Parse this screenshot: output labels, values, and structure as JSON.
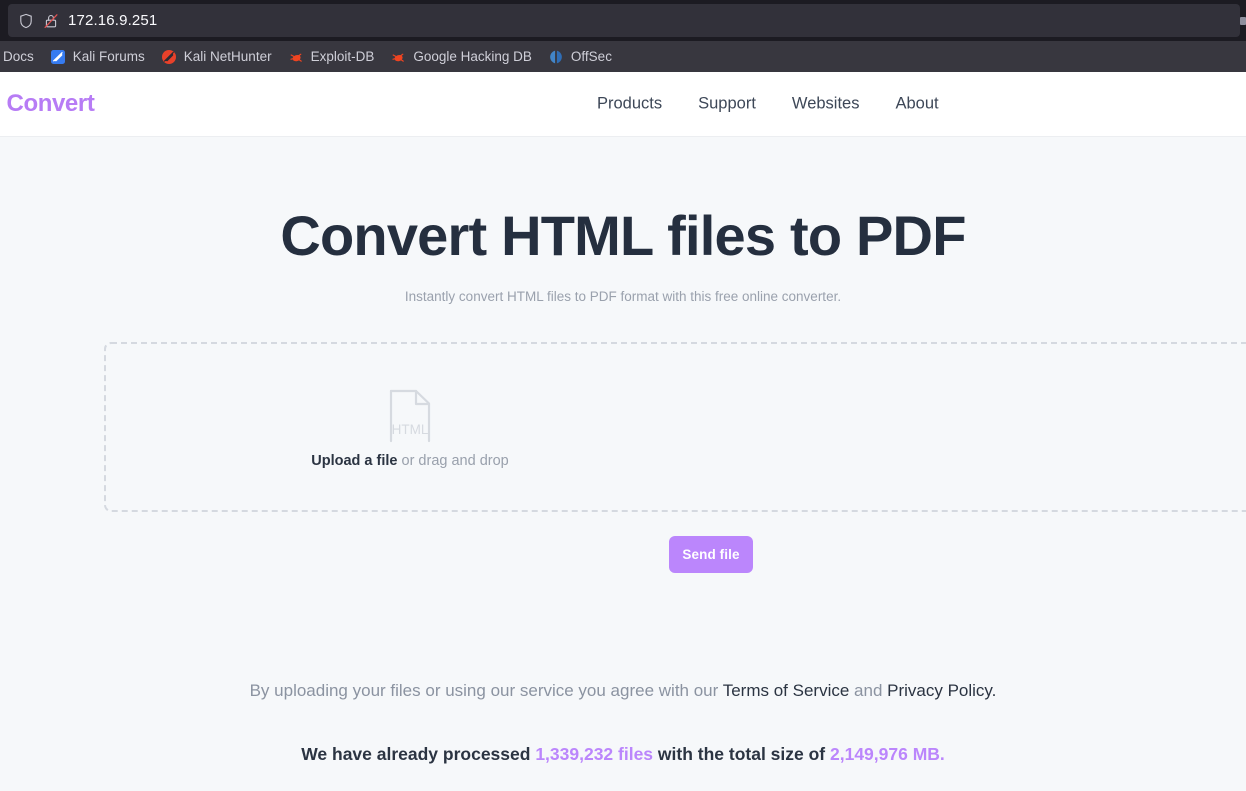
{
  "browser": {
    "url": "172.16.9.251",
    "shield_icon": "shield-icon",
    "lock_icon": "lock-crossed-out-icon",
    "bookmarks": [
      {
        "label": "Docs",
        "icon": "kali-docs-icon"
      },
      {
        "label": "Kali Forums",
        "icon": "kali-forums-icon"
      },
      {
        "label": "Kali NetHunter",
        "icon": "kali-nethunter-icon"
      },
      {
        "label": "Exploit-DB",
        "icon": "exploit-db-icon"
      },
      {
        "label": "Google Hacking DB",
        "icon": "google-hacking-db-icon"
      },
      {
        "label": "OffSec",
        "icon": "offsec-icon"
      }
    ]
  },
  "site": {
    "logo_text": "o Convert",
    "nav": [
      {
        "label": "Products"
      },
      {
        "label": "Support"
      },
      {
        "label": "Websites"
      },
      {
        "label": "About"
      }
    ]
  },
  "hero": {
    "title": "Convert HTML files to PDF",
    "subtitle": "Instantly convert HTML files to PDF format with this free online converter."
  },
  "dropzone": {
    "file_icon_label": "HTML",
    "upload_strong": "Upload a file",
    "upload_rest": " or drag and drop"
  },
  "actions": {
    "send_file_label": "Send file"
  },
  "legal": {
    "prefix": "By uploading your files or using our service you agree with our ",
    "terms_label": "Terms of Service",
    "conjunction": " and ",
    "privacy_label": "Privacy Policy.",
    "suffix": ""
  },
  "stats": {
    "prefix": "We have already processed ",
    "files_count": "1,339,232 files",
    "middle": " with the total size of ",
    "total_size": "2,149,976 MB.",
    "accent_color": "#bb86fc"
  },
  "colors": {
    "accent": "#bb86fc",
    "page_bg": "#f6f8fa",
    "header_bg": "#ffffff",
    "text_dark": "#252f3f",
    "text_muted": "#9aa1ad",
    "chrome_bg": "#1c1b22",
    "bookmarks_bg": "#38373f"
  }
}
